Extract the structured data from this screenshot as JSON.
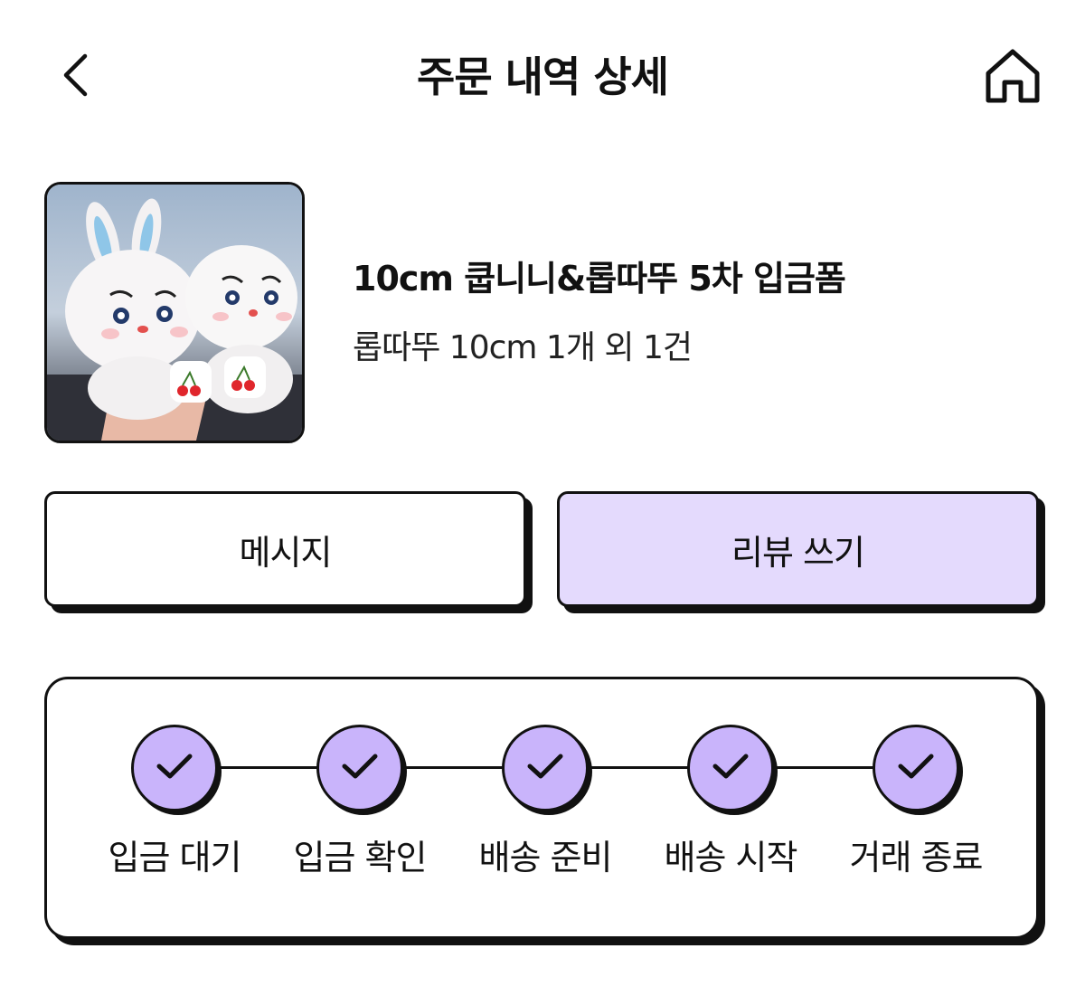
{
  "header": {
    "title": "주문 내역 상세",
    "back_icon": "chevron-left-icon",
    "home_icon": "home-icon"
  },
  "product": {
    "name": "10cm 쿱니니&롭따뚜 5차 입금폼",
    "summary": "롭따뚜 10cm 1개 외 1건",
    "thumbnail": "plush-dolls-photo"
  },
  "actions": {
    "message_label": "메시지",
    "review_label": "리뷰 쓰기"
  },
  "progress": {
    "steps": [
      {
        "label": "입금 대기",
        "done": true
      },
      {
        "label": "입금 확인",
        "done": true
      },
      {
        "label": "배송 준비",
        "done": true
      },
      {
        "label": "배송 시작",
        "done": true
      },
      {
        "label": "거래 종료",
        "done": true
      }
    ]
  },
  "colors": {
    "accent": "#c9b4fb",
    "review_button_bg": "#e4dafd",
    "border": "#111111"
  }
}
